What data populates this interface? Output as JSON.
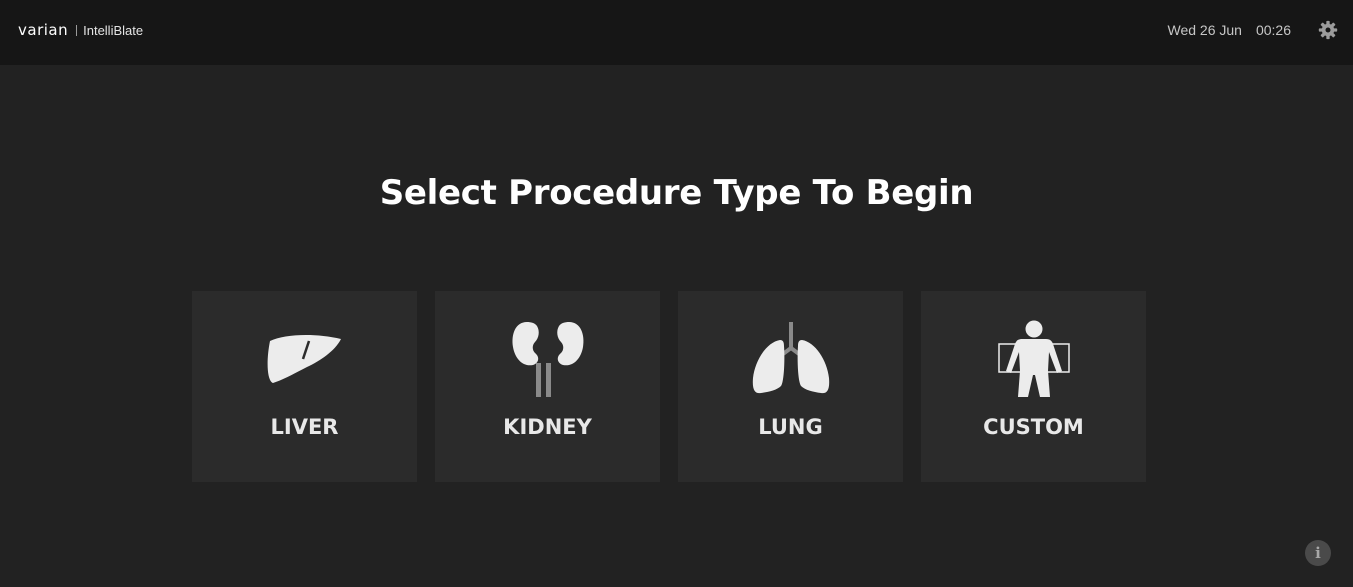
{
  "header": {
    "brand": "varian",
    "app_name": "IntelliBlate",
    "date": "Wed 26 Jun",
    "time": "00:26",
    "settings_icon": "gear-icon"
  },
  "main": {
    "title": "Select Procedure Type To Begin",
    "procedures": [
      {
        "label": "LIVER",
        "icon": "liver-icon"
      },
      {
        "label": "KIDNEY",
        "icon": "kidney-icon"
      },
      {
        "label": "LUNG",
        "icon": "lung-icon"
      },
      {
        "label": "CUSTOM",
        "icon": "body-icon"
      }
    ]
  },
  "footer": {
    "info_icon": "info-icon",
    "info_glyph": "i"
  },
  "colors": {
    "background": "#222222",
    "topbar": "#161616",
    "tile": "#2b2b2b",
    "icon_fill": "#ececec",
    "icon_secondary": "#8a8a8a"
  }
}
